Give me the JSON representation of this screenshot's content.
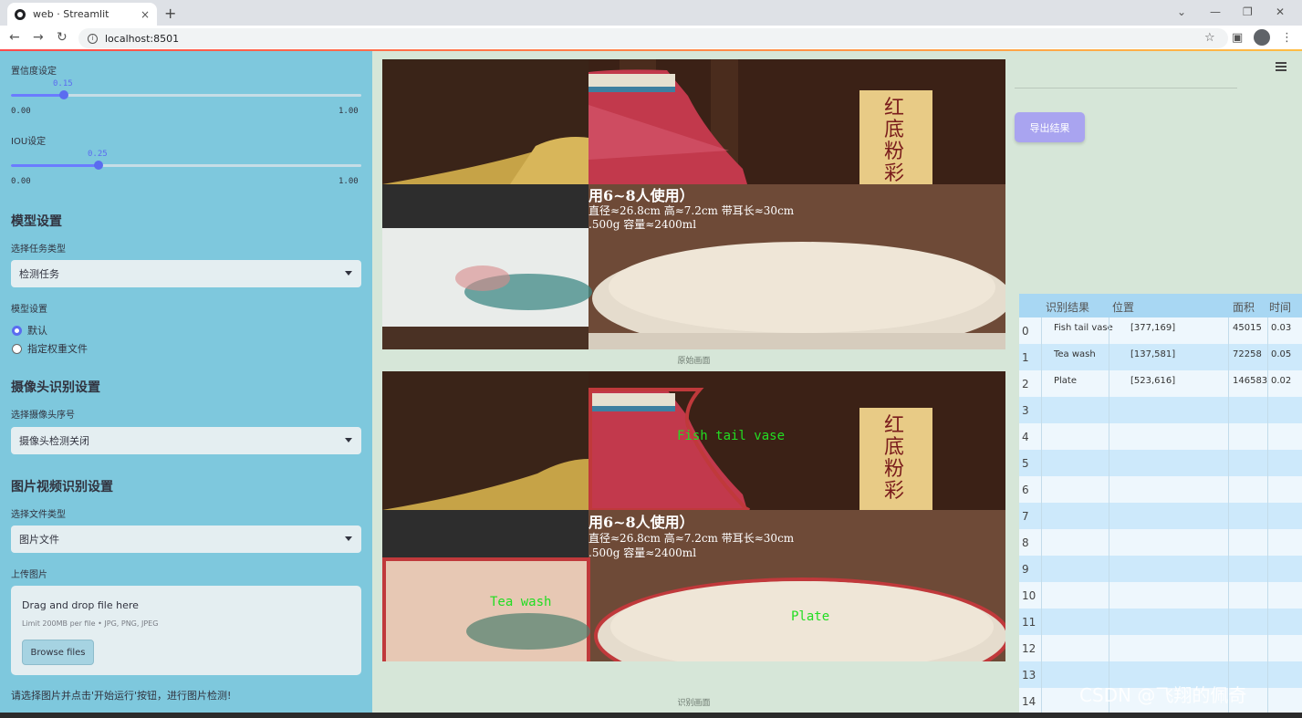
{
  "browser": {
    "tab_title": "web · Streamlit",
    "url": "localhost:8501",
    "new_tab": "+",
    "close_tab": "×"
  },
  "sidebar": {
    "confidence": {
      "label": "置信度设定",
      "value": "0.15",
      "min": "0.00",
      "max": "1.00",
      "fraction": 0.15
    },
    "iou": {
      "label": "IOU设定",
      "value": "0.25",
      "min": "0.00",
      "max": "1.00",
      "fraction": 0.25
    },
    "model_header": "模型设置",
    "task_label": "选择任务类型",
    "task_value": "检测任务",
    "model_label": "模型设置",
    "model_options": [
      "默认",
      "指定权重文件"
    ],
    "camera_header": "摄像头识别设置",
    "camera_label": "选择摄像头序号",
    "camera_value": "摄像头检测关闭",
    "media_header": "图片视频识别设置",
    "filetype_label": "选择文件类型",
    "filetype_value": "图片文件",
    "upload_label": "上传图片",
    "upload_drag": "Drag and drop file here",
    "upload_limit": "Limit 200MB per file • JPG, PNG, JPEG",
    "upload_button": "Browse files",
    "footer_hint": "请选择图片并点击'开始运行'按钮，进行图片检测!"
  },
  "main": {
    "export_button": "导出结果",
    "original_caption": "原始画面",
    "result_caption": "识别画面",
    "image_text": {
      "vertical_title": "红底粉彩鱼尾",
      "headline": "用6~8人使用）",
      "spec1": "直径≈26.8cm 高≈7.2cm 带耳长≈30cm",
      "spec2": ".500g 容量≈2400ml"
    },
    "detections": [
      "Fish tail vase",
      "Tea wash",
      "Plate"
    ]
  },
  "table": {
    "headers": [
      "识别结果",
      "位置",
      "面积",
      "时间"
    ],
    "rows": [
      {
        "idx": "0",
        "result": "Fish tail vase",
        "pos": "[377,169]",
        "area": "45015",
        "time": "0.03"
      },
      {
        "idx": "1",
        "result": "Tea wash",
        "pos": "[137,581]",
        "area": "72258",
        "time": "0.05"
      },
      {
        "idx": "2",
        "result": "Plate",
        "pos": "[523,616]",
        "area": "146583",
        "time": "0.02"
      },
      {
        "idx": "3"
      },
      {
        "idx": "4"
      },
      {
        "idx": "5"
      },
      {
        "idx": "6"
      },
      {
        "idx": "7"
      },
      {
        "idx": "8"
      },
      {
        "idx": "9"
      },
      {
        "idx": "10"
      },
      {
        "idx": "11"
      },
      {
        "idx": "12"
      },
      {
        "idx": "13"
      },
      {
        "idx": "14"
      }
    ]
  },
  "watermark": "CSDN @飞翔的佩奇",
  "colors": {
    "sidebar": "#7ec8dd",
    "main": "#d6e6d8",
    "accent": "#5b6cf0",
    "detect_box": "#c0393b",
    "detect_text": "#22dd22"
  }
}
